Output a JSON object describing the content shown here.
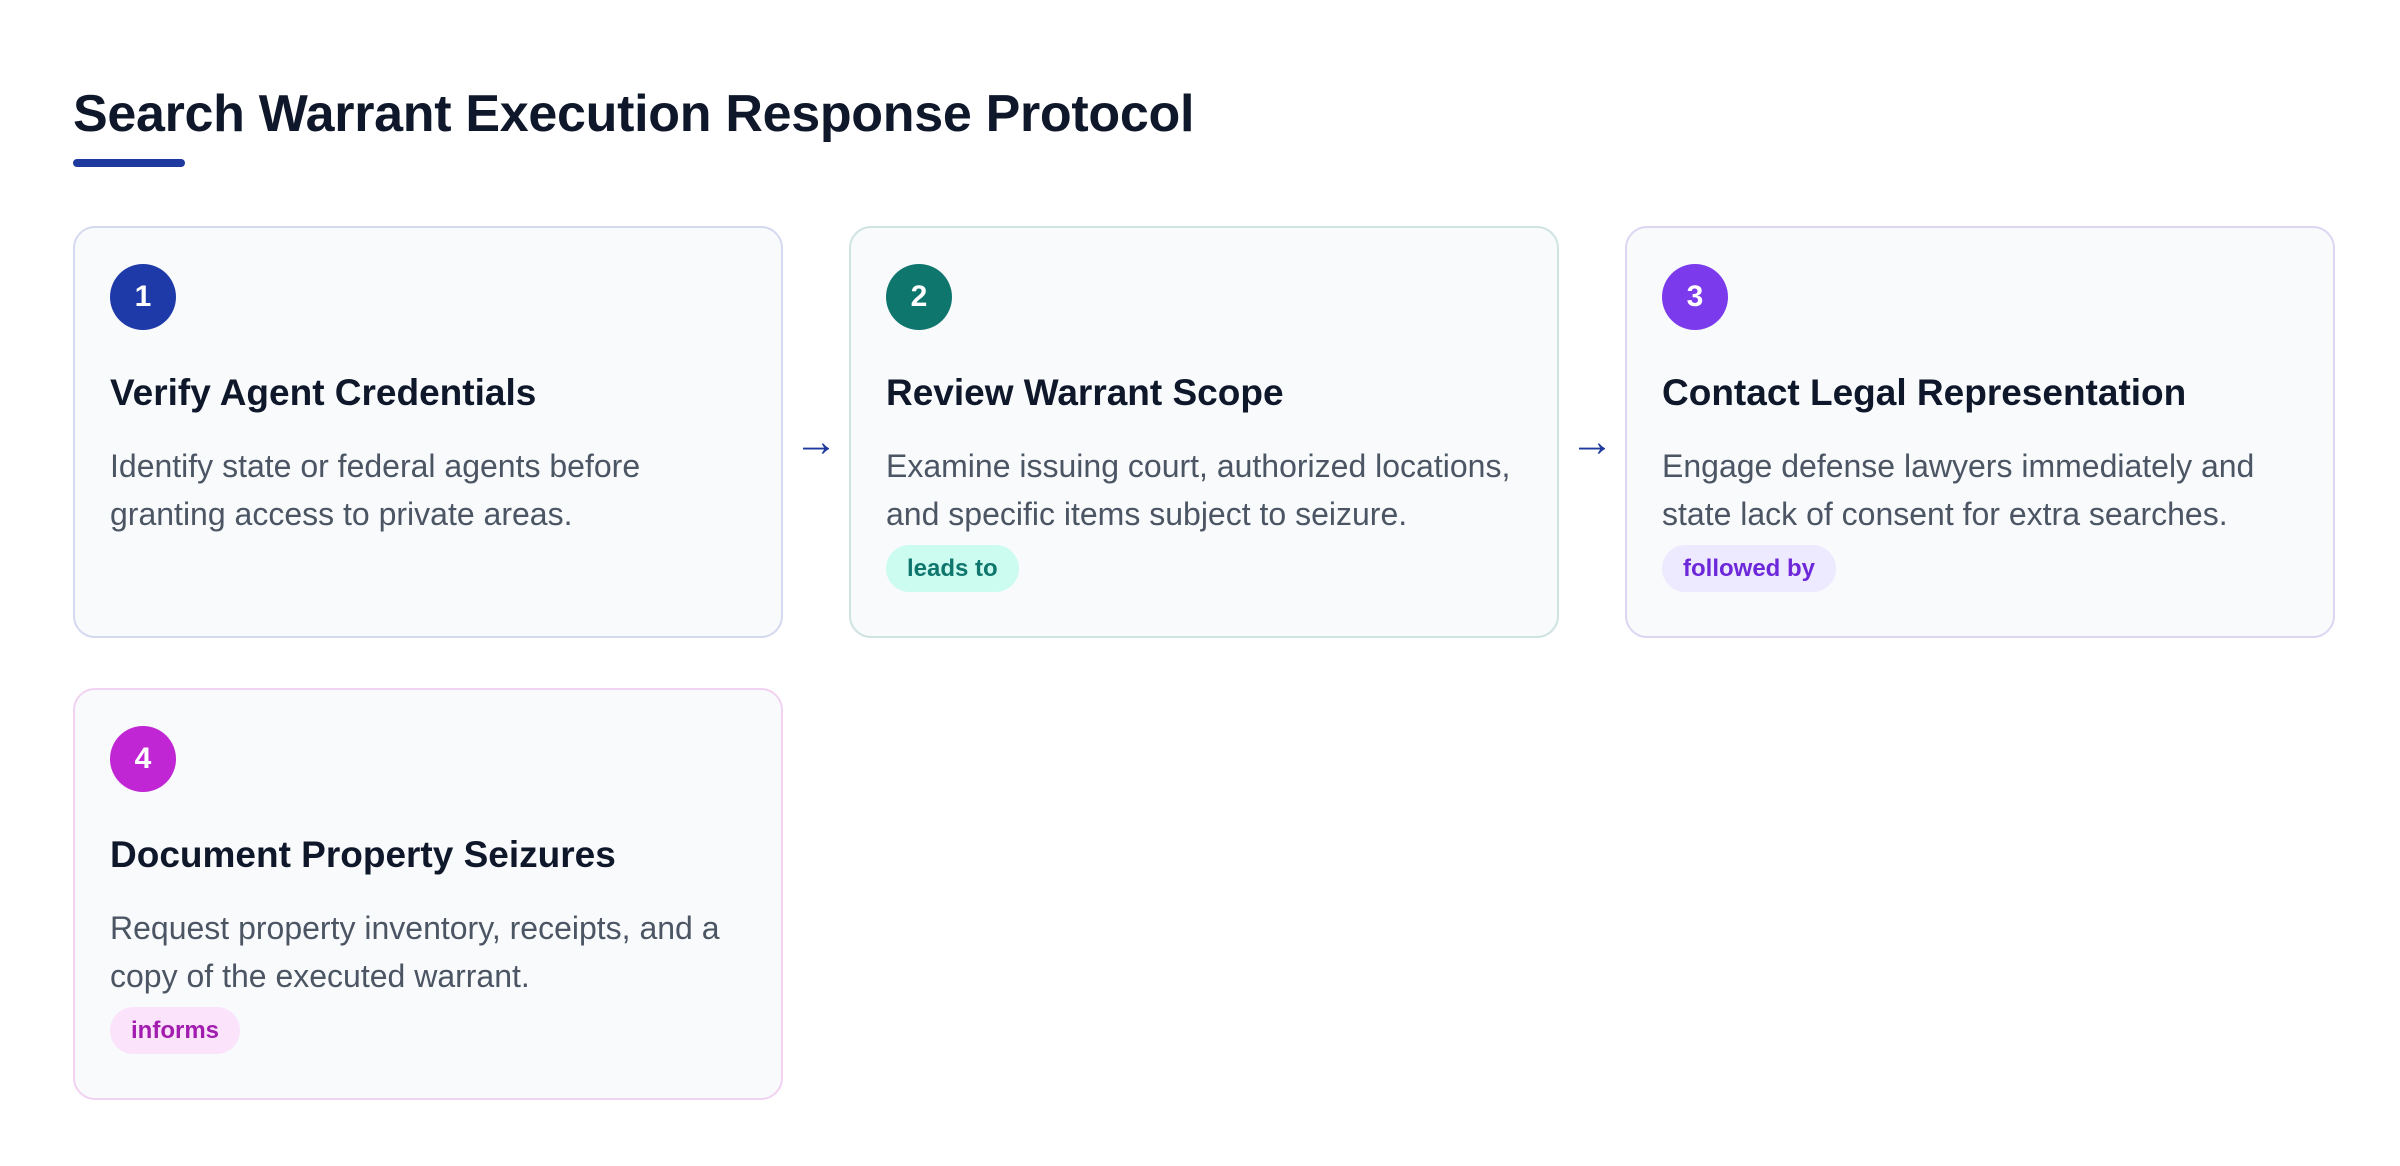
{
  "title": "Search Warrant Execution Response Protocol",
  "colors": {
    "accent": "#1e3a9e",
    "step1": "#1e3aa8",
    "step2": "#0f766e",
    "step3": "#7c3aed",
    "step4": "#c026d3"
  },
  "steps": [
    {
      "number": "1",
      "title": "Verify Agent Credentials",
      "description": "Identify state or federal agents before granting access to private areas.",
      "tag": ""
    },
    {
      "number": "2",
      "title": "Review Warrant Scope",
      "description": "Examine issuing court, authorized locations, and specific items subject to seizure.",
      "tag": "leads to"
    },
    {
      "number": "3",
      "title": "Contact Legal Representation",
      "description": "Engage defense lawyers immediately and state lack of consent for extra searches.",
      "tag": "followed by"
    },
    {
      "number": "4",
      "title": "Document Property Seizures",
      "description": "Request property inventory, receipts, and a copy of the executed warrant.",
      "tag": "informs"
    }
  ],
  "connectors": [
    "→",
    "→"
  ]
}
